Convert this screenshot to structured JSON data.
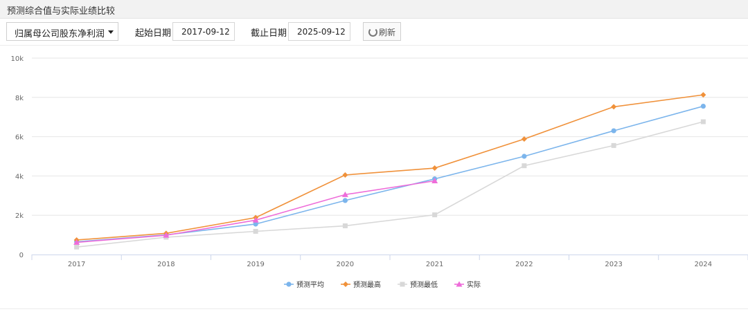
{
  "header": {
    "title": "预测综合值与实际业绩比较"
  },
  "toolbar": {
    "metric_selected": "归属母公司股东净利润",
    "start_label": "起始日期",
    "start_value": "2017-09-12",
    "end_label": "截止日期",
    "end_value": "2025-09-12",
    "refresh_label": "刷新"
  },
  "colors": {
    "avg": "#7cb5ec",
    "high": "#f0913a",
    "low": "#d8d8d8",
    "actual": "#ee6cd9",
    "grid": "#e6e6e6"
  },
  "chart_data": {
    "type": "line",
    "categories": [
      "2017",
      "2018",
      "2019",
      "2020",
      "2021",
      "2022",
      "2023",
      "2024"
    ],
    "ylim": [
      0,
      10000
    ],
    "yticks": [
      0,
      2000,
      4000,
      6000,
      8000,
      10000
    ],
    "ytick_labels": [
      "0",
      "2k",
      "4k",
      "6k",
      "8k",
      "10k"
    ],
    "series": [
      {
        "name": "预测平均",
        "color": "#7cb5ec",
        "marker": "circle",
        "values": [
          650,
          1000,
          1550,
          2750,
          3850,
          5000,
          6300,
          7550
        ]
      },
      {
        "name": "预测最高",
        "color": "#f0913a",
        "marker": "diamond",
        "values": [
          740,
          1080,
          1880,
          4050,
          4400,
          5880,
          7520,
          8130
        ]
      },
      {
        "name": "预测最低",
        "color": "#d8d8d8",
        "marker": "square",
        "values": [
          380,
          880,
          1180,
          1460,
          2020,
          4520,
          5550,
          6760
        ]
      },
      {
        "name": "实际",
        "color": "#ee6cd9",
        "marker": "triangle",
        "values": [
          620,
          980,
          1750,
          3050,
          3750,
          null,
          null,
          null
        ]
      }
    ],
    "legend_position": "bottom-center",
    "grid": true
  }
}
